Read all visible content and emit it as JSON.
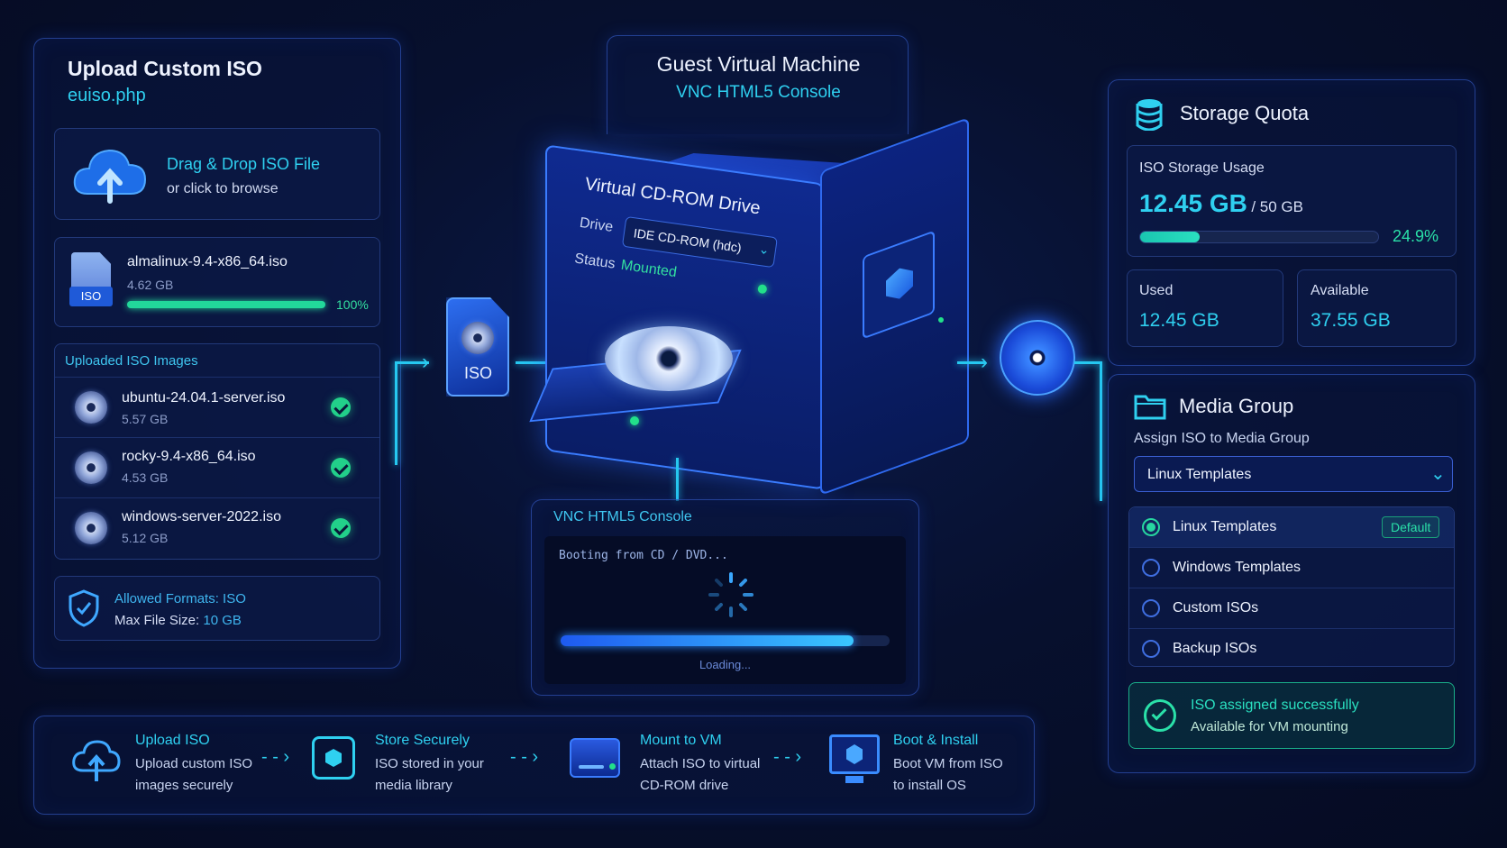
{
  "upload": {
    "title": "Upload Custom ISO",
    "page": "euiso.php",
    "dropzone": {
      "title": "Drag & Drop ISO File",
      "subtitle": "or click to browse"
    },
    "current": {
      "name": "almalinux-9.4-x86_64.iso",
      "size": "4.62 GB",
      "badge": "ISO",
      "progress_label": "100%",
      "progress": 1.0
    },
    "uploaded_header": "Uploaded ISO Images",
    "uploaded": [
      {
        "name": "ubuntu-24.04.1-server.iso",
        "size": "5.57 GB"
      },
      {
        "name": "rocky-9.4-x86_64.iso",
        "size": "4.53 GB"
      },
      {
        "name": "windows-server-2022.iso",
        "size": "5.12 GB"
      }
    ],
    "formats_label": "Allowed Formats:",
    "formats_value": "ISO",
    "maxsize_label": "Max File Size:",
    "maxsize_value": "10 GB"
  },
  "vm": {
    "title": "Guest Virtual Machine",
    "subtitle": "VNC HTML5 Console",
    "iso_tag": "ISO",
    "drive_title": "Virtual CD-ROM Drive",
    "drive_label": "Drive",
    "drive_value": "IDE CD-ROM (hdc)",
    "status_label": "Status",
    "status_value": "Mounted"
  },
  "console": {
    "title": "VNC HTML5 Console",
    "boot_text": "Booting from CD / DVD...",
    "loading": "Loading...",
    "progress": 0.89
  },
  "storage": {
    "title": "Storage Quota",
    "usage_label": "ISO Storage Usage",
    "used_big": "12.45 GB",
    "total": "/ 50 GB",
    "percent_label": "24.9%",
    "percent": 0.249,
    "used_label": "Used",
    "used_value": "12.45 GB",
    "available_label": "Available",
    "available_value": "37.55 GB"
  },
  "media": {
    "title": "Media Group",
    "assign_label": "Assign ISO to Media Group",
    "selected": "Linux Templates",
    "options": [
      {
        "label": "Linux Templates",
        "badge": "Default"
      },
      {
        "label": "Windows Templates"
      },
      {
        "label": "Custom ISOs"
      },
      {
        "label": "Backup ISOs"
      }
    ],
    "success_title": "ISO assigned successfully",
    "success_sub": "Available for VM mounting"
  },
  "steps": [
    {
      "title": "Upload ISO",
      "line1": "Upload custom ISO",
      "line2": "images securely",
      "icon": "cloud-upload-icon"
    },
    {
      "title": "Store Securely",
      "line1": "ISO stored in your",
      "line2": "media library",
      "icon": "secure-box-icon"
    },
    {
      "title": "Mount to VM",
      "line1": "Attach ISO to virtual",
      "line2": "CD-ROM drive",
      "icon": "drive-icon"
    },
    {
      "title": "Boot & Install",
      "line1": "Boot VM from ISO",
      "line2": "to install OS",
      "icon": "monitor-icon"
    }
  ],
  "colors": {
    "accent": "#2fd0f0",
    "success": "#22d08a",
    "border": "#3f6ee0",
    "background": "#07102e"
  }
}
